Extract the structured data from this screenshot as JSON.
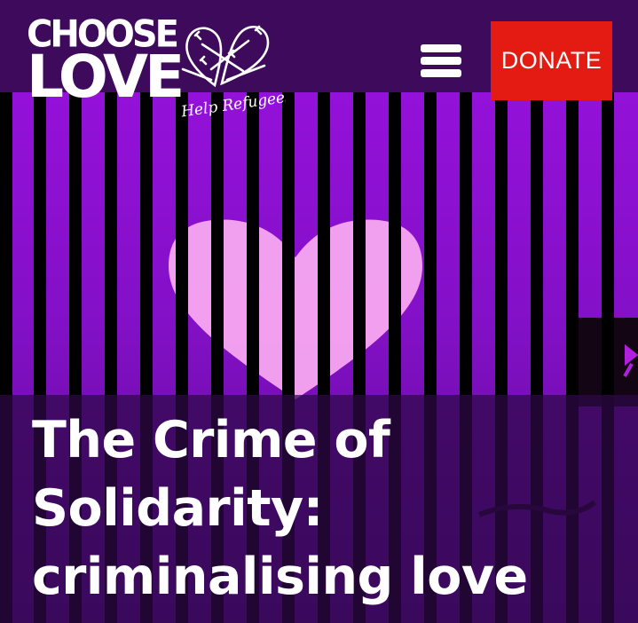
{
  "header": {
    "logo_word_1": "CHOOSE",
    "logo_word_2": "LOVE",
    "partner_logo_text": "Help Refugees",
    "menu_icon": "hamburger-menu-icon",
    "donate_label": "DONATE"
  },
  "hero": {
    "image_subject": "pink heart behind black bars on purple background",
    "headline": "The Crime of Solidarity: criminalising love"
  },
  "colors": {
    "header_bg": "#3d0a5c",
    "hero_purple": "#8a14d0",
    "bars": "#000000",
    "heart": "#f7a8f0",
    "donate_bg": "#e31b12",
    "text": "#ffffff"
  }
}
